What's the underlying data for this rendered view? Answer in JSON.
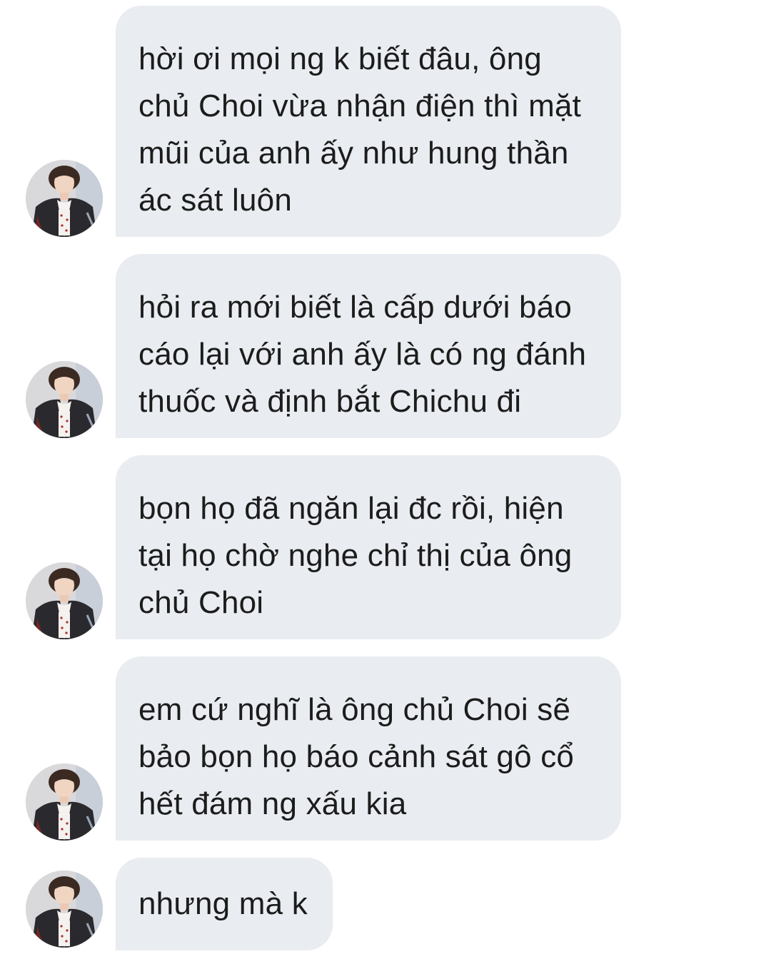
{
  "chat": {
    "messages": [
      {
        "text": "hời ơi mọi ng k biết đâu, ông\nchủ Choi vừa nhận điện thì mặt\nmũi của anh ấy như hung thần\nác sát luôn",
        "avatar_icon": "user-photo-avatar"
      },
      {
        "text": "hỏi ra mới biết là cấp dưới báo\ncáo lại với anh ấy là có ng đánh\nthuốc và định bắt Chichu đi",
        "avatar_icon": "user-photo-avatar"
      },
      {
        "text": "bọn họ đã ngăn lại đc rồi, hiện\ntại họ chờ nghe chỉ thị của ông\nchủ Choi",
        "avatar_icon": "user-photo-avatar"
      },
      {
        "text": "em cứ nghĩ là ông chủ Choi sẽ\nbảo bọn họ báo cảnh sát gô cổ\nhết đám ng xấu kia",
        "avatar_icon": "user-photo-avatar"
      },
      {
        "text": "nhưng mà k",
        "avatar_icon": "user-photo-avatar"
      }
    ]
  },
  "colors": {
    "bubble_bg": "#e9ecf0",
    "text": "#1c1c1c",
    "background": "#ffffff"
  }
}
